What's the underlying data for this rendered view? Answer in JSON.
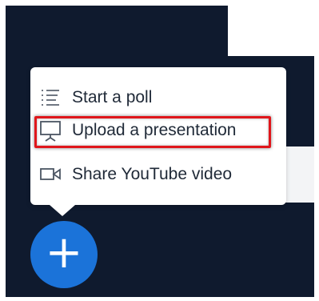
{
  "menu": {
    "items": [
      {
        "label": "Start a poll",
        "icon": "list-icon"
      },
      {
        "label": "Upload a presentation",
        "icon": "presentation-icon"
      },
      {
        "label": "Share YouTube video",
        "icon": "video-camera-icon"
      }
    ]
  },
  "fab": {
    "symbol": "+"
  },
  "colors": {
    "panel_bg": "#0f1a2e",
    "fab_bg": "#1b73d9",
    "highlight": "#e0161b"
  }
}
